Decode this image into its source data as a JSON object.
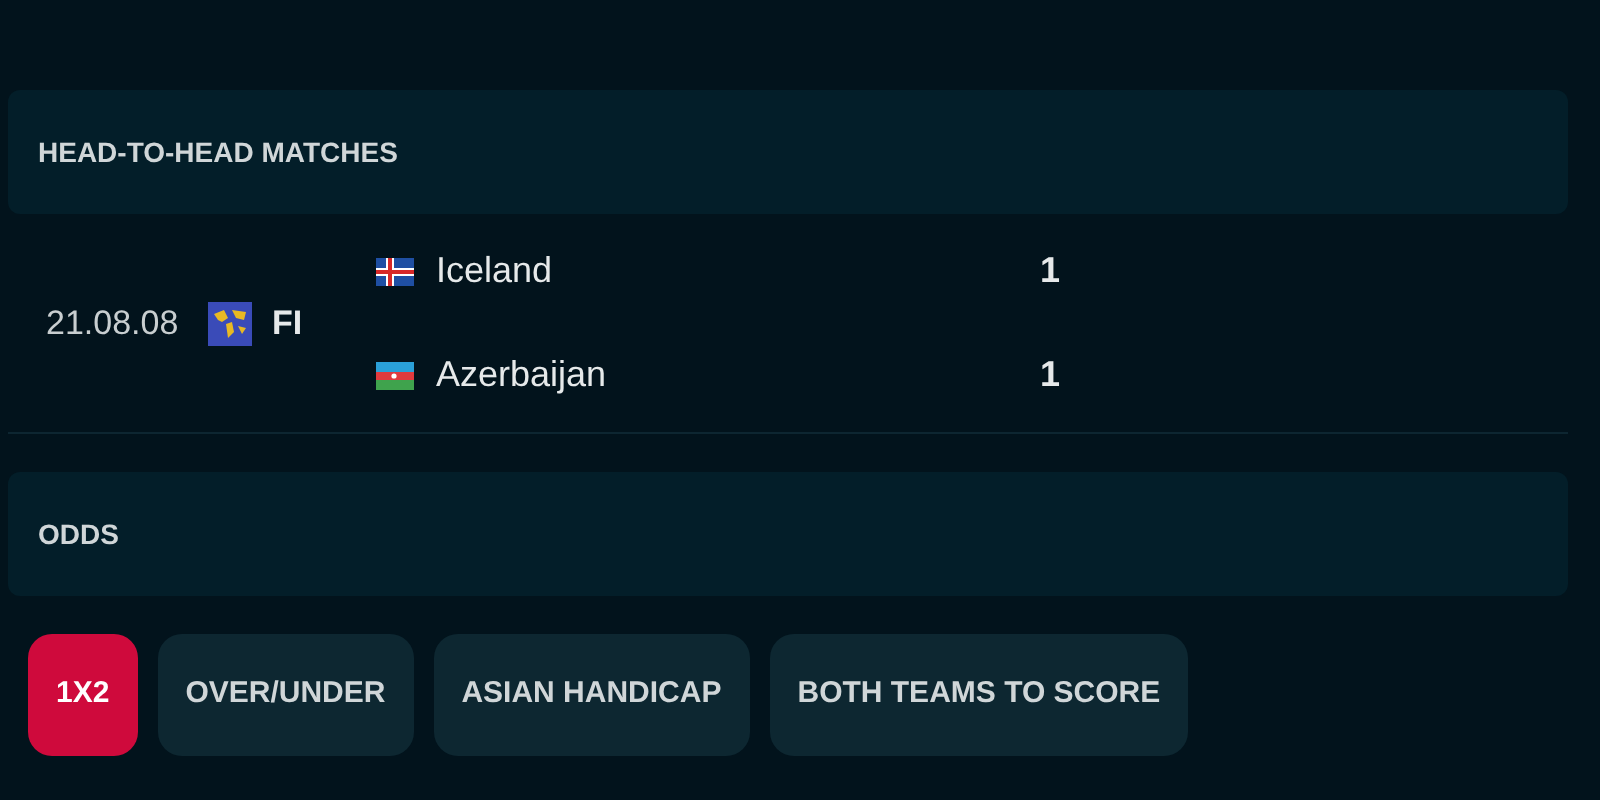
{
  "head_to_head": {
    "title": "HEAD-TO-HEAD MATCHES",
    "matches": [
      {
        "date": "21.08.08",
        "competition": "FI",
        "teams": [
          {
            "name": "Iceland",
            "kind": "iceland",
            "score": "1"
          },
          {
            "name": "Azerbaijan",
            "kind": "azerbaijan",
            "score": "1"
          }
        ]
      }
    ]
  },
  "odds": {
    "title": "ODDS",
    "tabs": [
      {
        "label": "1X2",
        "selected": true
      },
      {
        "label": "OVER/UNDER",
        "selected": false
      },
      {
        "label": "ASIAN HANDICAP",
        "selected": false
      },
      {
        "label": "BOTH TEAMS TO SCORE",
        "selected": false
      }
    ]
  }
}
